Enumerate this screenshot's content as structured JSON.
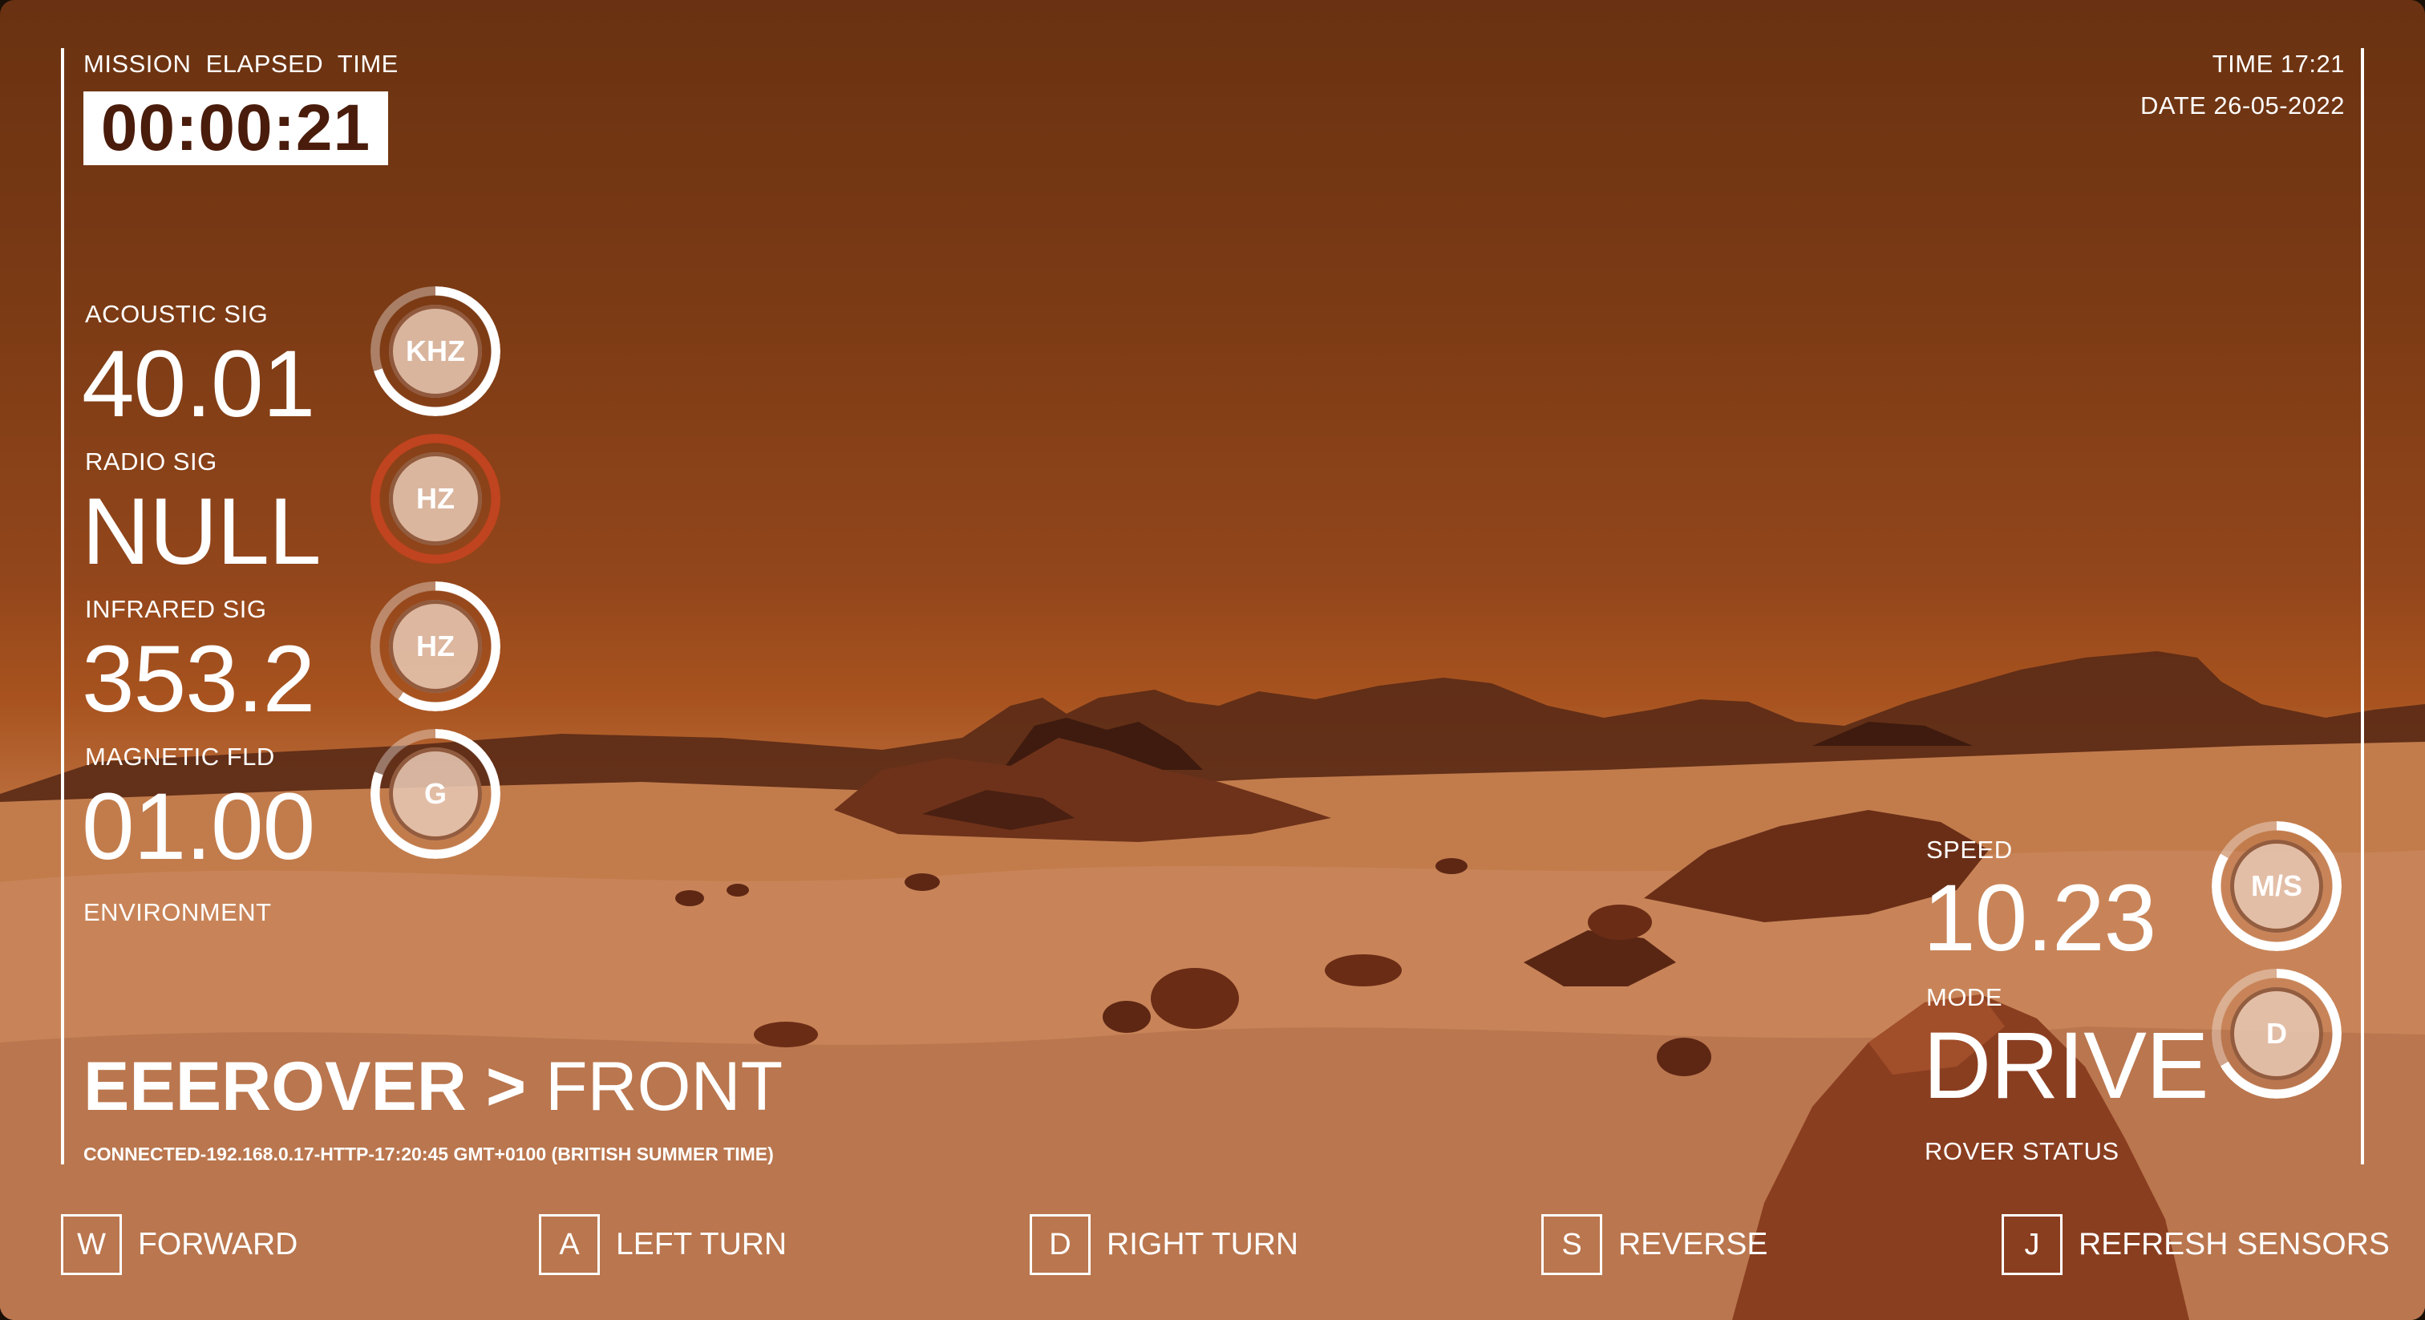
{
  "mission": {
    "label": "MISSION  ELAPSED  TIME",
    "elapsed": "00:00:21"
  },
  "clock": {
    "time": "TIME 17:21",
    "date": "DATE 26-05-2022"
  },
  "environment": {
    "section_label": "ENVIRONMENT",
    "sensors": [
      {
        "label": "ACOUSTIC SIG",
        "value": "40.01",
        "unit": "KHZ",
        "status": "ok"
      },
      {
        "label": "RADIO SIG",
        "value": "NULL",
        "unit": "HZ",
        "status": "error"
      },
      {
        "label": "INFRARED SIG",
        "value": "353.2",
        "unit": "HZ",
        "status": "ok"
      },
      {
        "label": "MAGNETIC FLD",
        "value": "01.00",
        "unit": "G",
        "status": "ok"
      }
    ]
  },
  "rover_status": {
    "section_label": "ROVER STATUS",
    "speed": {
      "label": "SPEED",
      "value": "10.23",
      "unit": "M/S"
    },
    "mode": {
      "label": "MODE",
      "value": "DRIVE",
      "unit": "D"
    }
  },
  "header": {
    "rover": "EEEROVER",
    "separator": ">",
    "view": "FRONT"
  },
  "connection": "CONNECTED-192.168.0.17-HTTP-17:20:45 GMT+0100 (BRITISH SUMMER TIME)",
  "controls": [
    {
      "key": "W",
      "label": "FORWARD"
    },
    {
      "key": "A",
      "label": "LEFT TURN"
    },
    {
      "key": "D",
      "label": "RIGHT TURN"
    },
    {
      "key": "S",
      "label": "REVERSE"
    },
    {
      "key": "J",
      "label": "REFRESH SENSORS"
    }
  ],
  "colors": {
    "sky_top": "#6a3212",
    "sky_horizon": "#a8531f",
    "ground": "#c07a48",
    "ring_ok": "#ffffff",
    "ring_error": "#c0441f",
    "timer_text": "#4a1c0b"
  },
  "icons": {
    "gauge": "circular-gauge"
  }
}
